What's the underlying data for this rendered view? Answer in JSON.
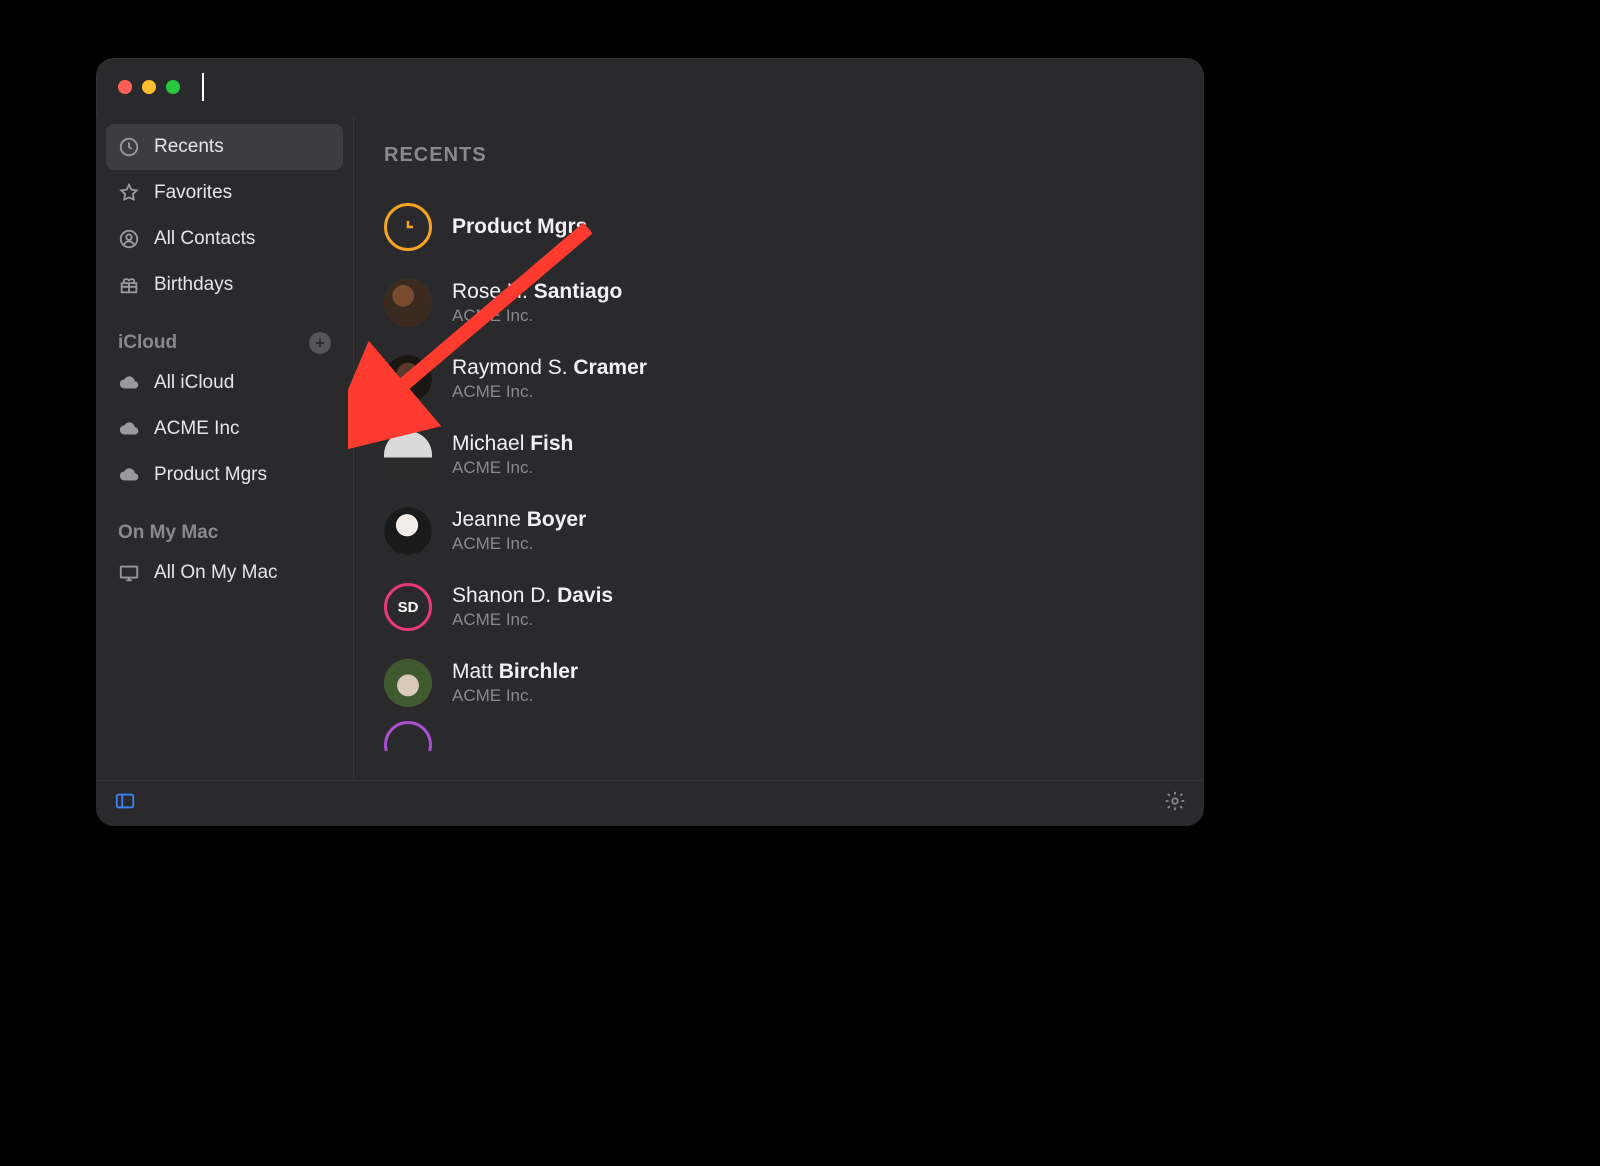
{
  "sidebar": {
    "top_items": [
      {
        "label": "Recents",
        "icon": "clock-icon",
        "selected": true
      },
      {
        "label": "Favorites",
        "icon": "star-icon",
        "selected": false
      },
      {
        "label": "All Contacts",
        "icon": "person-icon",
        "selected": false
      },
      {
        "label": "Birthdays",
        "icon": "gift-icon",
        "selected": false
      }
    ],
    "sections": [
      {
        "title": "iCloud",
        "has_add": true,
        "items": [
          {
            "label": "All iCloud",
            "icon": "cloud-icon"
          },
          {
            "label": "ACME Inc",
            "icon": "cloud-icon"
          },
          {
            "label": "Product Mgrs",
            "icon": "cloud-icon"
          }
        ]
      },
      {
        "title": "On My Mac",
        "has_add": false,
        "items": [
          {
            "label": "All On My Mac",
            "icon": "mac-icon"
          }
        ]
      }
    ]
  },
  "main": {
    "header": "RECENTS",
    "contacts": [
      {
        "name_pre": "",
        "name_bold": "Product Mgrs",
        "sub": "",
        "avatar": "clock-ring"
      },
      {
        "name_pre": "Rose H. ",
        "name_bold": "Santiago",
        "sub": "ACME Inc.",
        "avatar": "photo1"
      },
      {
        "name_pre": "Raymond S. ",
        "name_bold": "Cramer",
        "sub": "ACME Inc.",
        "avatar": "photo2"
      },
      {
        "name_pre": "Michael ",
        "name_bold": "Fish",
        "sub": "ACME Inc.",
        "avatar": "photo3"
      },
      {
        "name_pre": "Jeanne ",
        "name_bold": "Boyer",
        "sub": "ACME Inc.",
        "avatar": "photo4"
      },
      {
        "name_pre": "Shanon D. ",
        "name_bold": "Davis",
        "sub": "ACME Inc.",
        "avatar": "initials-sd"
      },
      {
        "name_pre": "Matt ",
        "name_bold": "Birchler",
        "sub": "ACME Inc.",
        "avatar": "photo5"
      }
    ],
    "cutoff_avatar": "ring-purple"
  },
  "accent_colors": {
    "orange": "#f4a522",
    "pink": "#e9397a",
    "purple": "#a94fd0",
    "footer_icon": "#3b82f6"
  },
  "annotation": {
    "type": "arrow",
    "color": "#ff3b30",
    "points_to": "icloud-add-button"
  }
}
